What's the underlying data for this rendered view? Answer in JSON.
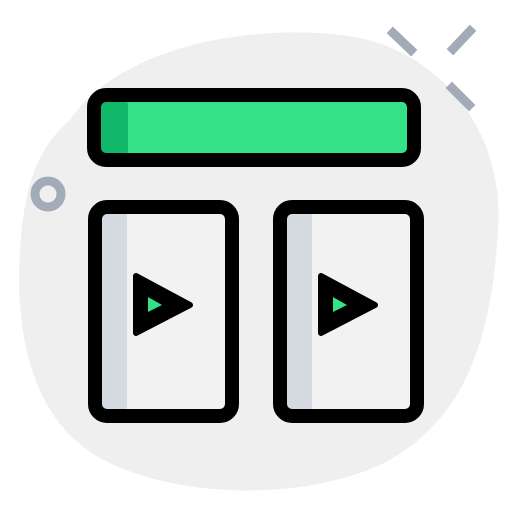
{
  "icon": {
    "name": "video-layout-icon",
    "colors": {
      "background_blob": "#efefef",
      "header_bar": "#34e088",
      "header_bar_shade": "#12b86a",
      "panel_fill": "#f2f2f2",
      "panel_shade": "#d6dbe1",
      "outline": "#000000",
      "play_fill": "#34e088",
      "decor_gray": "#a3aab8"
    }
  }
}
